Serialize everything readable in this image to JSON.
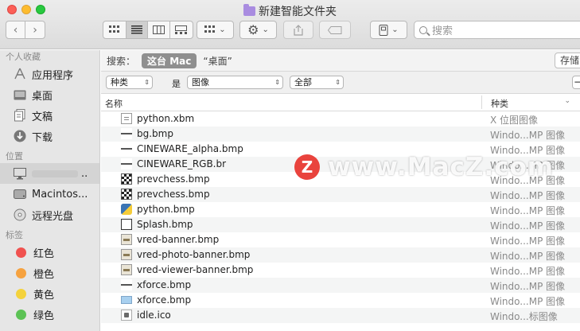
{
  "window": {
    "title": "新建智能文件夹"
  },
  "toolbar": {
    "search_placeholder": "搜索"
  },
  "sidebar": {
    "sections": [
      {
        "heading": "个人收藏",
        "items": [
          {
            "label": "应用程序",
            "icon": "applications-icon"
          },
          {
            "label": "桌面",
            "icon": "desktop-icon"
          },
          {
            "label": "文稿",
            "icon": "documents-icon"
          },
          {
            "label": "下载",
            "icon": "downloads-icon"
          }
        ]
      },
      {
        "heading": "位置",
        "items": [
          {
            "label": "..",
            "icon": "computer-icon",
            "selected": true
          },
          {
            "label": "Macintos...",
            "icon": "hard-disk-icon"
          },
          {
            "label": "远程光盘",
            "icon": "remote-disc-icon"
          }
        ]
      },
      {
        "heading": "标签",
        "items": [
          {
            "label": "红色",
            "color": "#f0524f"
          },
          {
            "label": "橙色",
            "color": "#f6a23f"
          },
          {
            "label": "黄色",
            "color": "#f4d23c"
          },
          {
            "label": "绿色",
            "color": "#5cc255"
          }
        ]
      }
    ]
  },
  "scope": {
    "label": "搜索：",
    "this_mac": "这台 Mac",
    "location": "“桌面”",
    "save_label": "存储"
  },
  "criteria": {
    "attribute": "种类",
    "operator": "是",
    "value": "图像",
    "qualifier": "全部",
    "remove_label": "−"
  },
  "columns": {
    "name": "名称",
    "kind": "种类"
  },
  "files": [
    {
      "name": "python.xbm",
      "kind": "X 位图图像",
      "icon": "xbm-file-icon"
    },
    {
      "name": "bg.bmp",
      "kind": "Windo...MP 图像",
      "icon": "bmp-file-icon"
    },
    {
      "name": "CINEWARE_alpha.bmp",
      "kind": "Windo...MP 图像",
      "icon": "bmp-file-icon"
    },
    {
      "name": "CINEWARE_RGB.br",
      "kind": "Windo...MP 图像",
      "icon": "bmp-file-icon"
    },
    {
      "name": "prevchess.bmp",
      "kind": "Windo...MP 图像",
      "icon": "checker-file-icon"
    },
    {
      "name": "prevchess.bmp",
      "kind": "Windo...MP 图像",
      "icon": "checker-file-icon"
    },
    {
      "name": "python.bmp",
      "kind": "Windo...MP 图像",
      "icon": "python-file-icon"
    },
    {
      "name": "Splash.bmp",
      "kind": "Windo...MP 图像",
      "icon": "square-file-icon"
    },
    {
      "name": "vred-banner.bmp",
      "kind": "Windo...MP 图像",
      "icon": "banner-file-icon"
    },
    {
      "name": "vred-photo-banner.bmp",
      "kind": "Windo...MP 图像",
      "icon": "banner-file-icon"
    },
    {
      "name": "vred-viewer-banner.bmp",
      "kind": "Windo...MP 图像",
      "icon": "banner-file-icon"
    },
    {
      "name": "xforce.bmp",
      "kind": "Windo...MP 图像",
      "icon": "bmp-file-icon"
    },
    {
      "name": "xforce.bmp",
      "kind": "Windo...MP 图像",
      "icon": "blue-file-icon"
    },
    {
      "name": "idle.ico",
      "kind": "Windo...标图像",
      "icon": "ico-file-icon"
    }
  ],
  "watermark": {
    "badge": "Z",
    "text": "www.MacZ.com"
  }
}
